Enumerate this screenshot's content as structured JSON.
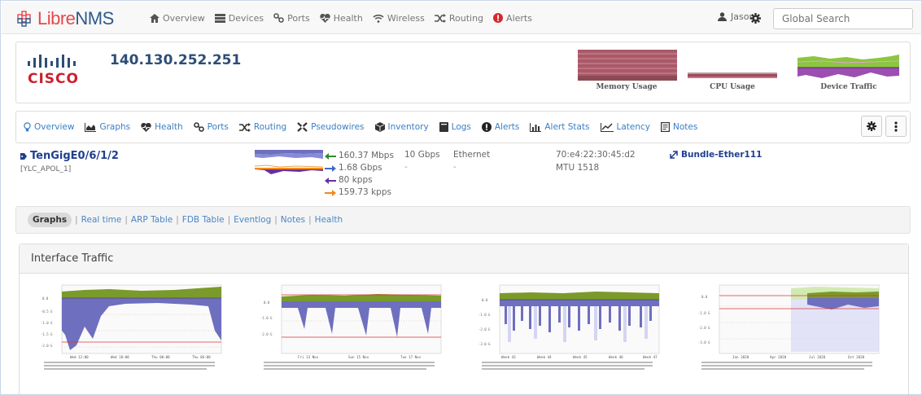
{
  "navbar": {
    "logo_libre": "Libre",
    "logo_nms": "NMS",
    "items": [
      {
        "icon": "home-icon",
        "label": "Overview"
      },
      {
        "icon": "server-icon",
        "label": "Devices"
      },
      {
        "icon": "link-icon",
        "label": "Ports"
      },
      {
        "icon": "heartbeat-icon",
        "label": "Health"
      },
      {
        "icon": "wifi-icon",
        "label": "Wireless"
      },
      {
        "icon": "random-icon",
        "label": "Routing"
      },
      {
        "icon": "alert-icon",
        "label": "Alerts"
      }
    ],
    "user": "Jason",
    "search_placeholder": "Global Search"
  },
  "device": {
    "vendor": "CISCO",
    "hostname": "140.130.252.251",
    "graphs": [
      {
        "label": "Memory Usage"
      },
      {
        "label": "CPU Usage"
      },
      {
        "label": "Device Traffic"
      }
    ]
  },
  "tabs": [
    {
      "icon": "lightbulb-icon",
      "label": "Overview"
    },
    {
      "icon": "area-chart-icon",
      "label": "Graphs"
    },
    {
      "icon": "heartbeat-icon",
      "label": "Health"
    },
    {
      "icon": "link-icon",
      "label": "Ports"
    },
    {
      "icon": "random-icon",
      "label": "Routing"
    },
    {
      "icon": "pseudowire-icon",
      "label": "Pseudowires"
    },
    {
      "icon": "cube-icon",
      "label": "Inventory"
    },
    {
      "icon": "book-icon",
      "label": "Logs"
    },
    {
      "icon": "alert-icon",
      "label": "Alerts"
    },
    {
      "icon": "bar-chart-icon",
      "label": "Alert Stats"
    },
    {
      "icon": "line-chart-icon",
      "label": "Latency"
    },
    {
      "icon": "notes-icon",
      "label": "Notes"
    }
  ],
  "port": {
    "name": "TenGigE0/6/1/2",
    "alias": "[YLC_APOL_1]",
    "rates": [
      {
        "direction": "in",
        "value": "160.37 Mbps",
        "color": "#2e8b2e"
      },
      {
        "direction": "out",
        "value": "1.68 Gbps",
        "color": "#3f6cc5"
      },
      {
        "direction": "in-pkts",
        "value": "80 kpps",
        "color": "#6a2f9e"
      },
      {
        "direction": "out-pkts",
        "value": "159.73 kpps",
        "color": "#f08a1c"
      }
    ],
    "speed": "10 Gbps",
    "speed_extra": "-",
    "type": "Ethernet",
    "type_extra": "-",
    "mac": "70:e4:22:30:45:d2",
    "mtu": "MTU 1518",
    "bundle": "Bundle-Ether111"
  },
  "subnav": {
    "items": [
      "Graphs",
      "Real time",
      "ARP Table",
      "FDB Table",
      "Eventlog",
      "Notes",
      "Health"
    ],
    "active": "Graphs"
  },
  "panel": {
    "title": "Interface Traffic",
    "graphs": [
      {
        "period": "day",
        "x_ticks": [
          "Wed 12:00",
          "Wed 18:00",
          "Thu 00:00",
          "Thu 06:00"
        ]
      },
      {
        "period": "week",
        "x_ticks": [
          "Fri 13 Nov",
          "Sun 15 Nov",
          "Tue 17 Nov"
        ]
      },
      {
        "period": "month",
        "x_ticks": [
          "Week 43",
          "Week 44",
          "Week 45",
          "Week 46",
          "Week 47"
        ]
      },
      {
        "period": "year",
        "x_ticks": [
          "Jan 2020",
          "Apr 2020",
          "Jul 2020",
          "Oct 2020"
        ]
      }
    ]
  },
  "colors": {
    "accent": "#3a7fc4",
    "in_area": "#7a9a2a",
    "out_area": "#6e6fbf",
    "limit_line": "#d33"
  }
}
